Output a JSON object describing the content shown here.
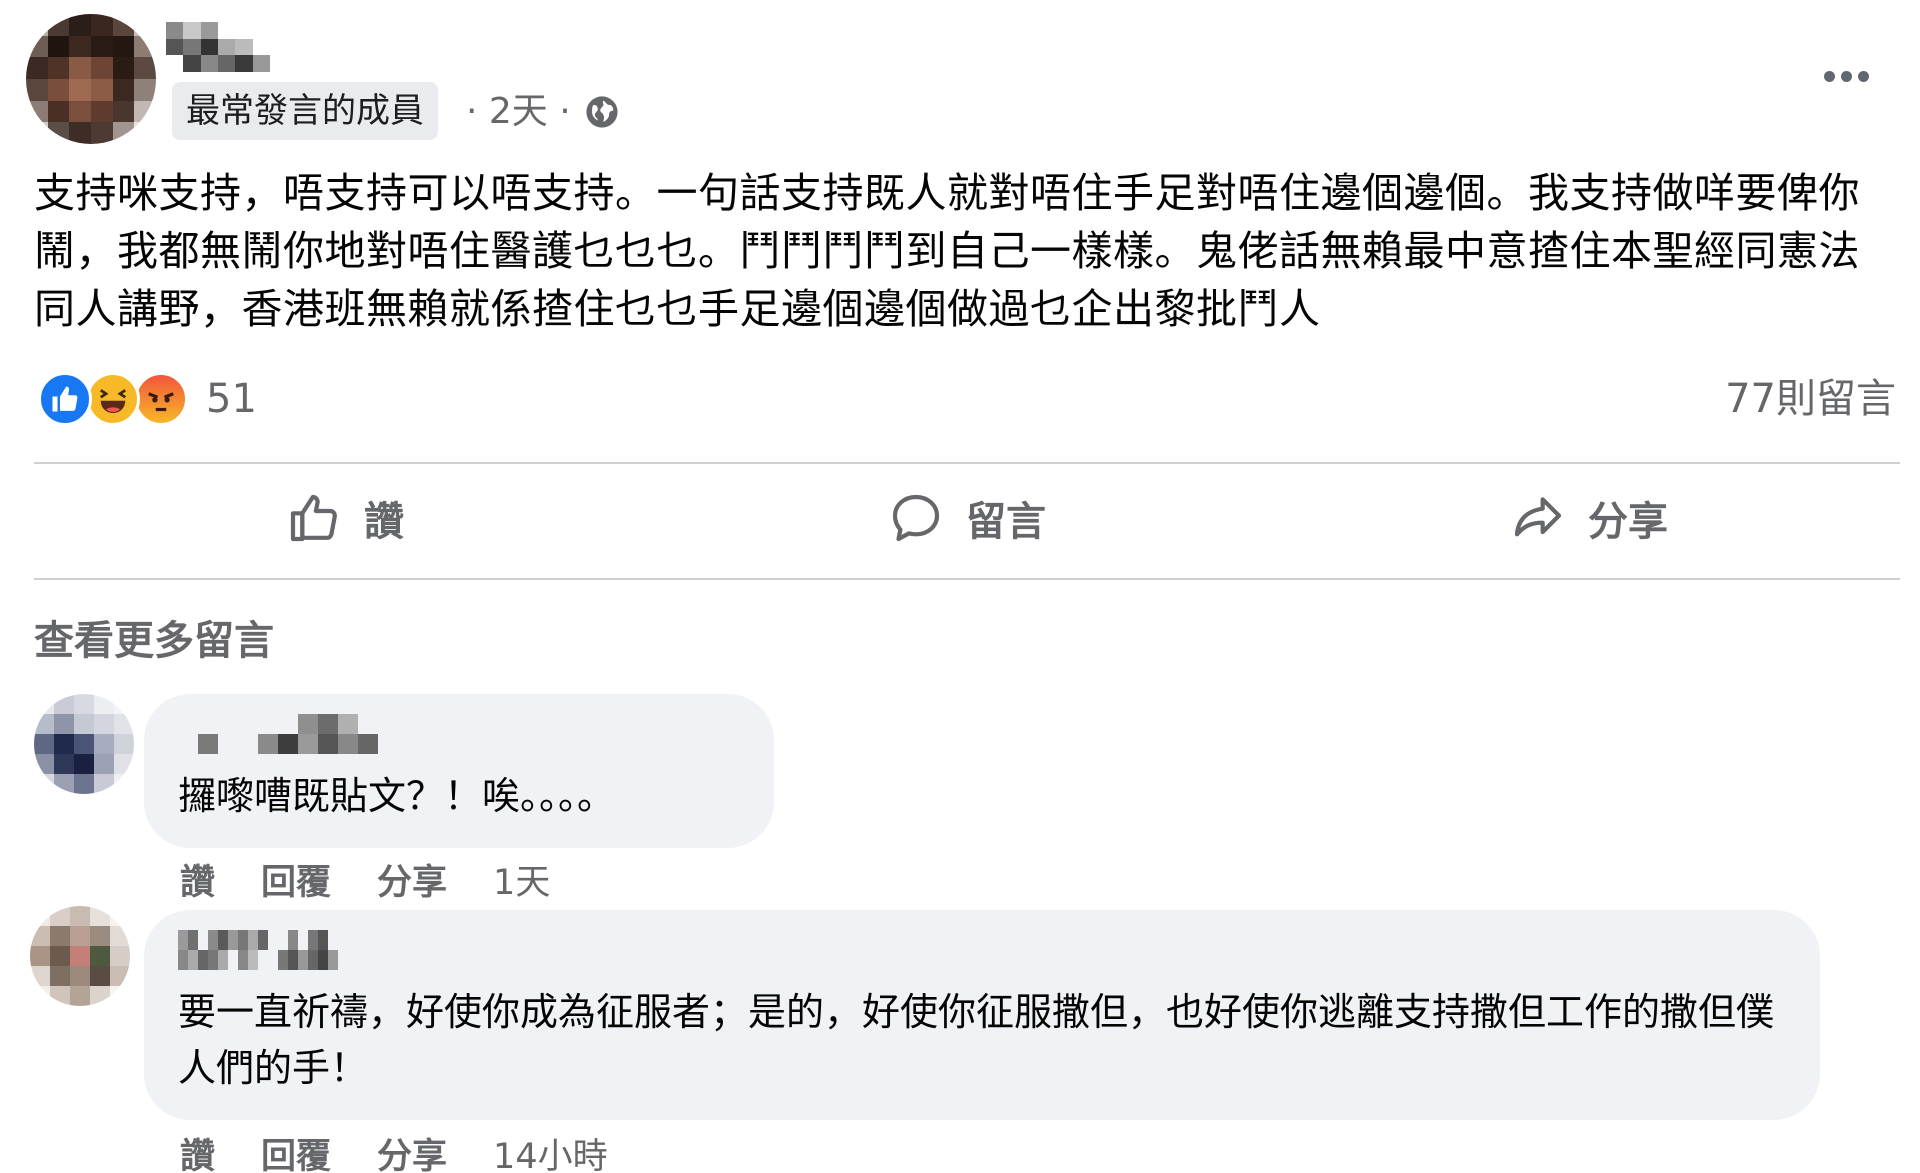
{
  "post": {
    "badge": "最常發言的成員",
    "time": "· 2天 ·",
    "privacy_icon": "globe-icon",
    "more_icon": "more-options-icon",
    "text": "支持咪支持，唔支持可以唔支持。一句話支持既人就對唔住手足對唔住邊個邊個。我支持做咩要俾你鬧，我都無鬧你地對唔住醫護乜乜乜。鬥鬥鬥鬥到自己一樣樣。鬼佬話無賴最中意揸住本聖經同憲法同人講野，香港班無賴就係揸住乜乜手足邊個邊個做過乜企出黎批鬥人"
  },
  "reactions": {
    "icons": [
      "like-icon",
      "haha-icon",
      "angry-icon"
    ],
    "count": "51",
    "comments_count": "77則留言",
    "colors": {
      "like": "#1877f2",
      "haha": "#f7b928",
      "angry": "#f2553b"
    }
  },
  "actions": {
    "like": "讚",
    "comment": "留言",
    "share": "分享"
  },
  "view_more_comments": "查看更多留言",
  "comments": [
    {
      "text": "攞嚟嘈既貼文？！唉。。。。",
      "like": "讚",
      "reply": "回覆",
      "share": "分享",
      "time": "1天"
    },
    {
      "text": "要一直祈禱，好使你成為征服者；是的，好使你征服撒但，也好使你逃離支持撒但工作的撒但僕人們的手！",
      "like": "讚",
      "reply": "回覆",
      "share": "分享",
      "time": "14小時"
    }
  ]
}
